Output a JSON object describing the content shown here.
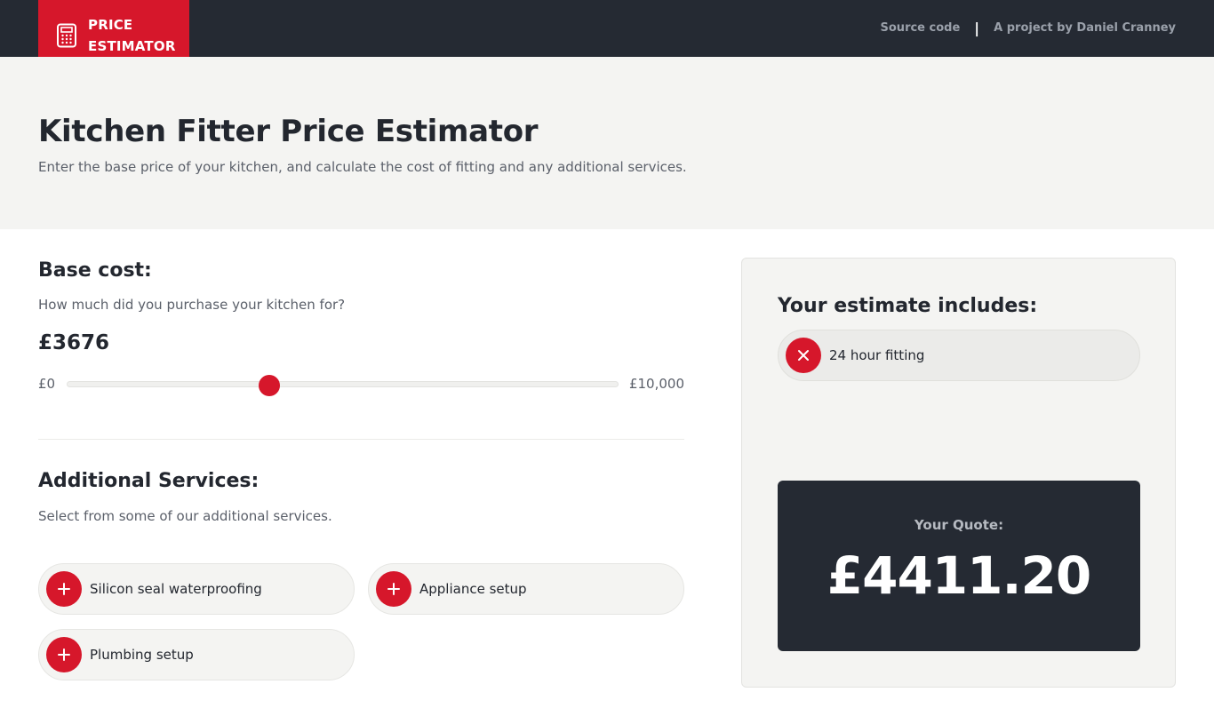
{
  "header": {
    "logo_line1": "PRICE",
    "logo_line2": "ESTIMATOR",
    "source_code_link": "Source code",
    "separator": "|",
    "author_link": "A project by Daniel Cranney"
  },
  "hero": {
    "title": "Kitchen Fitter Price Estimator",
    "subtitle": "Enter the base price of your kitchen, and calculate the cost of fitting and any additional services."
  },
  "base_cost": {
    "title": "Base cost:",
    "question": "How much did you purchase your kitchen for?",
    "value_display": "£3676",
    "slider_min_label": "£0",
    "slider_max_label": "£10,000",
    "slider_value": 3676,
    "slider_min": 0,
    "slider_max": 10000
  },
  "additional": {
    "title": "Additional Services:",
    "subtitle": "Select from some of our additional services.",
    "services": [
      {
        "label": "Silicon seal waterproofing",
        "icon": "plus-icon"
      },
      {
        "label": "Appliance setup",
        "icon": "plus-icon"
      },
      {
        "label": "Plumbing setup",
        "icon": "plus-icon"
      }
    ]
  },
  "estimate": {
    "title": "Your estimate includes:",
    "included": [
      {
        "label": "24 hour fitting",
        "icon": "close-icon"
      }
    ],
    "quote_label": "Your Quote:",
    "quote_value": "£4411.20"
  },
  "colors": {
    "accent": "#d6172b",
    "dark": "#252a33",
    "light_bg": "#f4f4f2"
  }
}
